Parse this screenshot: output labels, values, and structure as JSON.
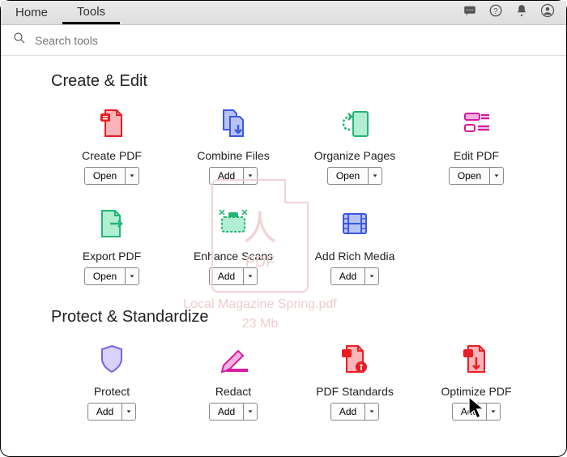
{
  "topbar": {
    "tabs": [
      "Home",
      "Tools"
    ],
    "active_tab": 1
  },
  "search": {
    "placeholder": "Search tools"
  },
  "sections": [
    {
      "title": "Create & Edit",
      "tools": [
        {
          "name": "create-pdf",
          "label": "Create PDF",
          "action": "Open",
          "icon": "create-pdf-icon"
        },
        {
          "name": "combine-files",
          "label": "Combine Files",
          "action": "Add",
          "icon": "combine-files-icon"
        },
        {
          "name": "organize-pages",
          "label": "Organize Pages",
          "action": "Open",
          "icon": "organize-pages-icon"
        },
        {
          "name": "edit-pdf",
          "label": "Edit PDF",
          "action": "Open",
          "icon": "edit-pdf-icon"
        },
        {
          "name": "export-pdf",
          "label": "Export PDF",
          "action": "Open",
          "icon": "export-pdf-icon"
        },
        {
          "name": "enhance-scans",
          "label": "Enhance Scans",
          "action": "Add",
          "icon": "enhance-scans-icon"
        },
        {
          "name": "add-rich-media",
          "label": "Add Rich Media",
          "action": "Add",
          "icon": "rich-media-icon"
        }
      ]
    },
    {
      "title": "Protect & Standardize",
      "tools": [
        {
          "name": "protect",
          "label": "Protect",
          "action": "Add",
          "icon": "shield-icon"
        },
        {
          "name": "redact",
          "label": "Redact",
          "action": "Add",
          "icon": "redact-icon"
        },
        {
          "name": "pdf-standards",
          "label": "PDF Standards",
          "action": "Add",
          "icon": "pdf-standards-icon"
        },
        {
          "name": "optimize-pdf",
          "label": "Optimize PDF",
          "action": "Add",
          "icon": "optimize-pdf-icon"
        }
      ]
    }
  ],
  "ghost_drop": {
    "ext": "PDF",
    "filename": "Local Magazine Spring.pdf",
    "size": "23 Mb"
  },
  "colors": {
    "red": "#ec1c24",
    "red_fill": "#f9b5b9",
    "blue": "#3b5ae0",
    "blue_fill": "#b9c2f5",
    "green": "#21b573",
    "green_fill": "#b2eed3",
    "magenta": "#d81b9e",
    "magenta_fill": "#f4b2e0",
    "purple": "#7a5fea"
  }
}
